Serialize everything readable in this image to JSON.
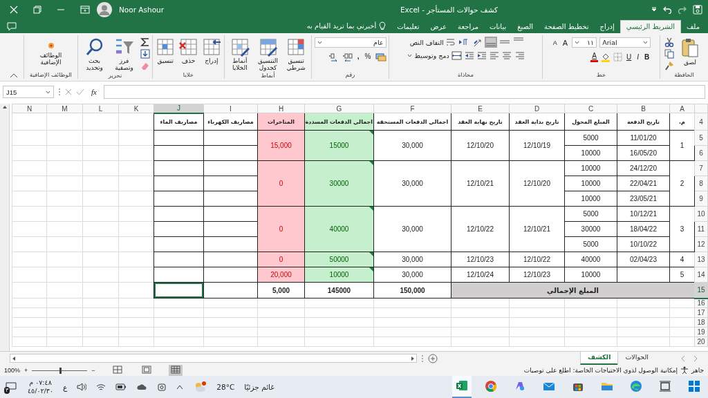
{
  "title_bar": {
    "title": "كشف حوالات المستأجر - Excel",
    "user": "Noor Ashour"
  },
  "tabs": [
    {
      "label": "ملف",
      "selected": false
    },
    {
      "label": "الشريط الرئيسي",
      "selected": true
    },
    {
      "label": "إدراج",
      "selected": false
    },
    {
      "label": "تخطيط الصفحة",
      "selected": false
    },
    {
      "label": "الصيغ",
      "selected": false
    },
    {
      "label": "بيانات",
      "selected": false
    },
    {
      "label": "مراجعة",
      "selected": false
    },
    {
      "label": "عرض",
      "selected": false
    },
    {
      "label": "تعليمات",
      "selected": false
    }
  ],
  "tell_me": "أخبرني بما تريد القيام به",
  "ribbon": {
    "groups": [
      {
        "kind": "clipboard",
        "label": "الحافظة",
        "paste": "لصق"
      },
      {
        "kind": "font",
        "label": "خط",
        "font": "Arial",
        "size": "١١",
        "grow": "A",
        "shrink": "A",
        "bold": "B",
        "italic": "I",
        "underline": "U",
        "font_color": "A"
      },
      {
        "kind": "alignment",
        "label": "محاذاة",
        "wrap": "التفاف النص",
        "merge": "دمج وتوسيط",
        "valign": [
          {
            "selected": false
          },
          {
            "selected": false
          },
          {
            "selected": true
          }
        ]
      },
      {
        "kind": "number",
        "label": "رقم",
        "format": "عام",
        "percent": "%",
        "comma": ","
      },
      {
        "kind": "styles",
        "label": "أنماط",
        "buttons": [
          "تنسيق شرطي",
          "التنسيق كجدول",
          "أنماط الخلايا"
        ]
      },
      {
        "kind": "cells",
        "label": "خلايا",
        "buttons": [
          "إدراج",
          "حذف",
          "تنسيق"
        ]
      },
      {
        "kind": "editing",
        "label": "تحرير",
        "sort": "فرز وتصفية",
        "find": "بحث وتحديد"
      },
      {
        "kind": "addins",
        "label": "الوظائف الإضافية",
        "button": "الوظائف الإضافية"
      }
    ]
  },
  "formula_bar": {
    "name_box": "J15",
    "fx": "fx"
  },
  "sheet": {
    "columns": [
      {
        "letter": "A",
        "selected": false
      },
      {
        "letter": "B",
        "selected": false
      },
      {
        "letter": "C",
        "selected": false
      },
      {
        "letter": "D",
        "selected": false
      },
      {
        "letter": "E",
        "selected": false
      },
      {
        "letter": "F",
        "selected": false
      },
      {
        "letter": "G",
        "selected": false
      },
      {
        "letter": "H",
        "selected": false
      },
      {
        "letter": "I",
        "selected": false
      },
      {
        "letter": "J",
        "selected": true
      },
      {
        "letter": "K",
        "selected": false
      },
      {
        "letter": "L",
        "selected": false
      },
      {
        "letter": "M",
        "selected": false
      },
      {
        "letter": "N",
        "selected": false
      }
    ],
    "header_row": {
      "row": "4",
      "cells": [
        {
          "text": "م."
        },
        {
          "text": "تاريخ الدفعة"
        },
        {
          "text": "المبلغ المحول"
        },
        {
          "text": "تاريخ بداية العقد"
        },
        {
          "text": "تاريخ نهاية العقد"
        },
        {
          "text": "اجمالي الدفعات المستحقة"
        },
        {
          "text": "اجمالي الدفعات المسددة",
          "color": "#c6efce"
        },
        {
          "text": "المتاخرات",
          "color": "#ffc7ce"
        },
        {
          "text": "مصاريف الكهرباء"
        },
        {
          "text": "مصاريف الماء"
        }
      ]
    },
    "payments": [
      {
        "number": "1",
        "start": "12/10/19",
        "end": "12/10/20",
        "due": "30,000",
        "paid": "15000",
        "paid_flag": true,
        "arrears": "15,000",
        "transfers": [
          {
            "row": "5",
            "date": "11/01/20",
            "amount": "5000"
          },
          {
            "row": "6",
            "date": "16/05/20",
            "amount": "10000"
          }
        ]
      },
      {
        "number": "2",
        "start": "12/10/20",
        "end": "12/10/21",
        "due": "30,000",
        "paid": "30000",
        "paid_flag": true,
        "arrears": "0",
        "transfers": [
          {
            "row": "7",
            "date": "24/12/20",
            "amount": "10000"
          },
          {
            "row": "8",
            "date": "22/04/21",
            "amount": "10000"
          },
          {
            "row": "9",
            "date": "23/05/21",
            "amount": "10000"
          }
        ]
      },
      {
        "number": "3",
        "start": "12/10/21",
        "end": "12/10/22",
        "due": "30,000",
        "paid": "40000",
        "paid_flag": true,
        "arrears": "0",
        "transfers": [
          {
            "row": "10",
            "date": "10/12/21",
            "amount": "5000"
          },
          {
            "row": "11",
            "date": "18/04/22",
            "amount": "30000"
          },
          {
            "row": "12",
            "date": "10/10/22",
            "amount": "5000"
          }
        ]
      },
      {
        "number": "4",
        "start": "12/10/22",
        "end": "12/10/23",
        "due": "30,000",
        "paid": "50000",
        "paid_flag": true,
        "arrears": "0",
        "transfers": [
          {
            "row": "13",
            "date": "02/04/23",
            "amount": "40000"
          }
        ]
      },
      {
        "number": "5",
        "start": "12/10/23",
        "end": "12/10/24",
        "due": "30,000",
        "paid": "10000",
        "paid_flag": true,
        "arrears": "20,000",
        "transfers": [
          {
            "row": "14",
            "amount": "10000"
          }
        ]
      }
    ],
    "total_row": {
      "row": "15",
      "selected": true,
      "label": "المبلغ الإجمالي",
      "color": "#d0cece",
      "due": "150,000",
      "paid": "145000",
      "arrears": "5,000"
    },
    "empty_rows": [
      "16",
      "17",
      "18",
      "19",
      "20"
    ]
  },
  "sheet_tabs": [
    {
      "label": "الحوالات",
      "selected": false
    },
    {
      "label": "الكشف",
      "selected": true
    }
  ],
  "status_bar": {
    "mode": "جاهز",
    "accessibility": "إمكانية الوصول لذوي الاحتياجات الخاصة: اطلع على توصيات",
    "views": [
      {
        "selected": true
      },
      {
        "selected": false
      },
      {
        "selected": false
      }
    ],
    "zoom": {
      "text": "100%",
      "zoom_in": "+",
      "zoom_out": "−",
      "level": 0.5
    }
  },
  "taskbar": {
    "apps": [
      {
        "kind": "start",
        "selected": false
      },
      {
        "kind": "taskview",
        "selected": false
      },
      {
        "kind": "edge",
        "selected": false
      },
      {
        "kind": "explorer",
        "selected": false
      },
      {
        "kind": "store",
        "selected": false
      },
      {
        "kind": "mail",
        "selected": false
      },
      {
        "kind": "copilot",
        "selected": false
      },
      {
        "kind": "chrome",
        "selected": false
      },
      {
        "kind": "excel",
        "selected": true
      }
    ],
    "weather": {
      "condition": "غائم جزئيًا",
      "temperature": "28°C"
    },
    "language": "ع",
    "time": "٠٧:٤٨ م",
    "date": "٤٥/٠٢/٣٠",
    "notifications": "٣"
  }
}
